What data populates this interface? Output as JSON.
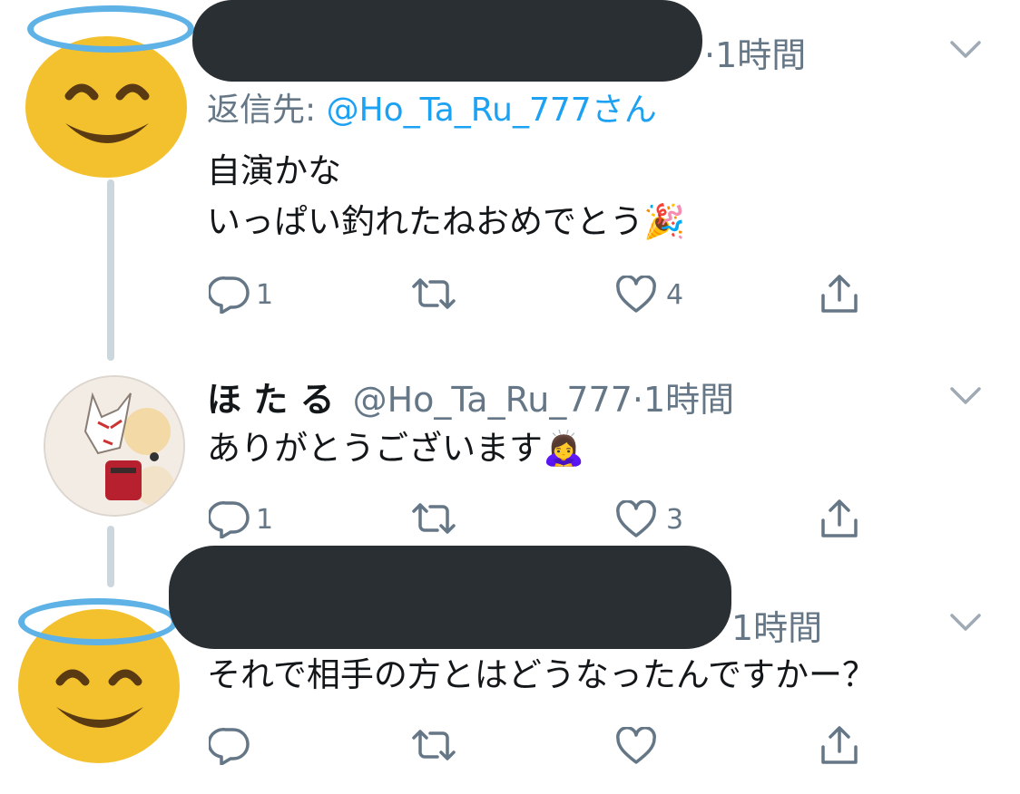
{
  "tweets": [
    {
      "name": "",
      "handle": "",
      "time": "·1時間",
      "reply_to_prefix": "返信先: ",
      "reply_to_handle": "@Ho_Ta_Ru_777",
      "reply_to_suffix": "さん",
      "text_lines": [
        "自演かな",
        "いっぱい釣れたねおめでとう🎉"
      ],
      "counts": {
        "reply": "1",
        "retweet": "",
        "like": "4"
      }
    },
    {
      "name": "ほ た る",
      "handle": "@Ho_Ta_Ru_777",
      "time": "·1時間",
      "text_lines": [
        "ありがとうございます🙇‍♀️"
      ],
      "counts": {
        "reply": "1",
        "retweet": "",
        "like": "3"
      }
    },
    {
      "name": "",
      "handle": "",
      "time": "1時間",
      "text_lines": [
        "それで相手の方とはどうなったんですかー？"
      ],
      "counts": {
        "reply": "",
        "retweet": "",
        "like": ""
      }
    }
  ],
  "icons": [
    "reply-icon",
    "retweet-icon",
    "like-icon",
    "share-icon",
    "chevron-down-icon"
  ],
  "colors": {
    "text": "#14171a",
    "muted": "#657786",
    "link": "#1da1f2",
    "line": "#ccd6dd",
    "redaction": "#2a2f34",
    "emoji": "#f4c12e",
    "halo": "#5fb2e6"
  }
}
